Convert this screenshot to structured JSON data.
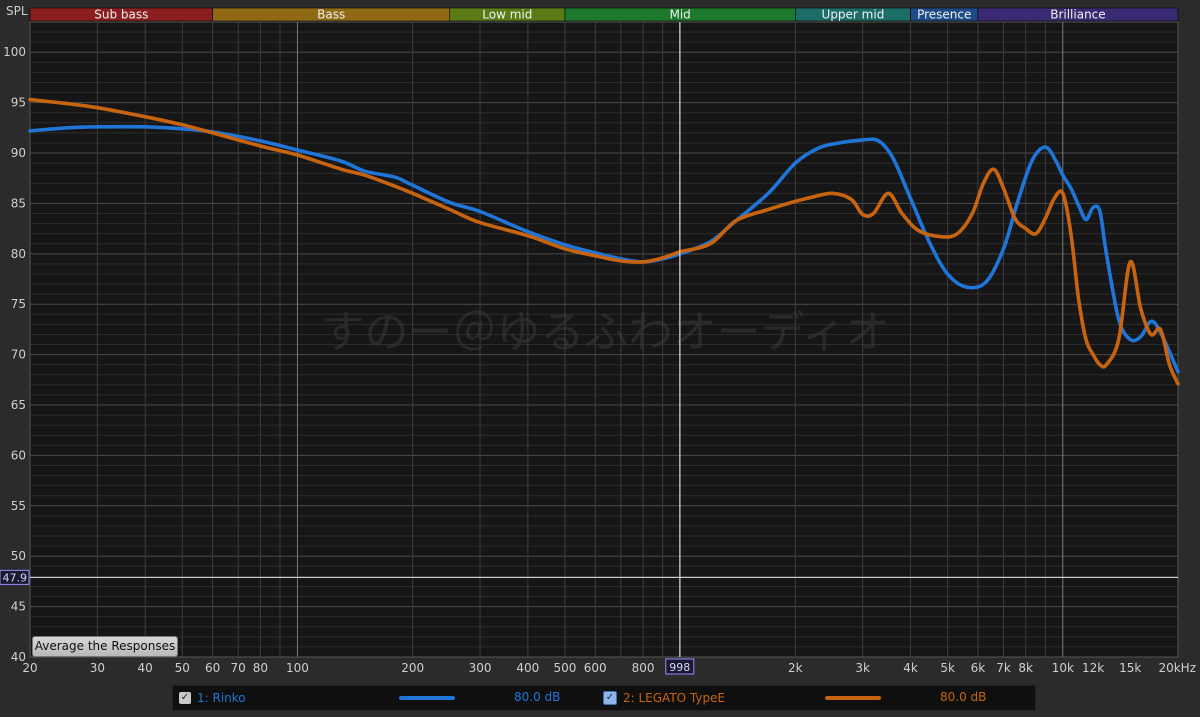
{
  "colors": {
    "background": "#161616",
    "grid": "#3a3a3a",
    "series1": "#1f75d8",
    "series2": "#c8640f",
    "cursor": "#e6e6e6"
  },
  "bands": [
    {
      "label": "Sub bass",
      "from": 20,
      "to": 60,
      "color": "#8b1f1f"
    },
    {
      "label": "Bass",
      "from": 60,
      "to": 250,
      "color": "#8f6a12"
    },
    {
      "label": "Low mid",
      "from": 250,
      "to": 500,
      "color": "#5b7b16"
    },
    {
      "label": "Mid",
      "from": 500,
      "to": 2000,
      "color": "#1d7a2c"
    },
    {
      "label": "Upper mid",
      "from": 2000,
      "to": 4000,
      "color": "#1c6c68"
    },
    {
      "label": "Presence",
      "from": 4000,
      "to": 6000,
      "color": "#1c4b86"
    },
    {
      "label": "Brilliance",
      "from": 6000,
      "to": 20000,
      "color": "#3a2a73"
    }
  ],
  "axis_label": "SPL",
  "cursor": {
    "x_label": "998",
    "y_label": "47.9"
  },
  "watermark": "すのー＠ゆるふわオーディオ",
  "button_label": "Average the Responses",
  "legend": [
    {
      "checked": "✓",
      "name": "1: Rinko",
      "value": "80.0 dB",
      "color": "#1f75d8"
    },
    {
      "checked": "✓",
      "name": "2: LEGATO TypeE",
      "value": "80.0 dB",
      "color": "#c8640f"
    }
  ],
  "chart_data": {
    "type": "line",
    "xscale": "log",
    "xlim": [
      20,
      20000
    ],
    "ylim": [
      40,
      103
    ],
    "x_ticks": [
      {
        "v": 20,
        "label": "20"
      },
      {
        "v": 30,
        "label": "30"
      },
      {
        "v": 40,
        "label": "40"
      },
      {
        "v": 50,
        "label": "50"
      },
      {
        "v": 60,
        "label": "60"
      },
      {
        "v": 70,
        "label": "70"
      },
      {
        "v": 80,
        "label": "80"
      },
      {
        "v": 100,
        "label": "100"
      },
      {
        "v": 200,
        "label": "200"
      },
      {
        "v": 300,
        "label": "300"
      },
      {
        "v": 400,
        "label": "400"
      },
      {
        "v": 500,
        "label": "500"
      },
      {
        "v": 600,
        "label": "600"
      },
      {
        "v": 800,
        "label": "800"
      },
      {
        "v": 2000,
        "label": "2k"
      },
      {
        "v": 3000,
        "label": "3k"
      },
      {
        "v": 4000,
        "label": "4k"
      },
      {
        "v": 5000,
        "label": "5k"
      },
      {
        "v": 6000,
        "label": "6k"
      },
      {
        "v": 7000,
        "label": "7k"
      },
      {
        "v": 8000,
        "label": "8k"
      },
      {
        "v": 10000,
        "label": "10k"
      },
      {
        "v": 12000,
        "label": "12k"
      },
      {
        "v": 15000,
        "label": "15k"
      },
      {
        "v": 20000,
        "label": "20kHz"
      }
    ],
    "y_ticks": [
      40,
      45,
      50,
      55,
      60,
      65,
      70,
      75,
      80,
      85,
      90,
      95,
      100
    ],
    "series": [
      {
        "name": "1: Rinko",
        "color": "#1f75d8",
        "x": [
          20,
          25,
          30,
          40,
          50,
          60,
          80,
          100,
          130,
          150,
          180,
          200,
          250,
          300,
          400,
          500,
          600,
          700,
          800,
          900,
          1000,
          1200,
          1400,
          1700,
          2000,
          2300,
          2600,
          3000,
          3300,
          3600,
          4000,
          4500,
          5000,
          5600,
          6300,
          7000,
          7600,
          8300,
          9000,
          9600,
          10000,
          10500,
          11000,
          11500,
          12000,
          12500,
          13000,
          14000,
          15000,
          16000,
          17000,
          18000,
          20000
        ],
        "y": [
          92.2,
          92.5,
          92.6,
          92.6,
          92.4,
          92.1,
          91.2,
          90.3,
          89.2,
          88.2,
          87.6,
          86.8,
          85.1,
          84.2,
          82.2,
          80.9,
          80.1,
          79.5,
          79.2,
          79.5,
          80.0,
          81.2,
          83.3,
          86.0,
          89.0,
          90.5,
          91.0,
          91.3,
          91.2,
          89.5,
          85.5,
          81.0,
          78.0,
          76.7,
          77.2,
          80.5,
          85.0,
          89.2,
          90.6,
          89.2,
          87.8,
          86.5,
          84.8,
          83.4,
          84.6,
          84.2,
          80.0,
          73.5,
          71.5,
          71.8,
          73.3,
          72.2,
          68.3
        ]
      },
      {
        "name": "2: LEGATO TypeE",
        "color": "#c8640f",
        "x": [
          20,
          25,
          30,
          40,
          50,
          60,
          80,
          100,
          130,
          150,
          180,
          200,
          250,
          300,
          400,
          500,
          600,
          700,
          800,
          900,
          1000,
          1200,
          1400,
          1700,
          2000,
          2200,
          2500,
          2800,
          3000,
          3200,
          3500,
          3800,
          4200,
          4800,
          5300,
          5800,
          6200,
          6600,
          7000,
          7500,
          8000,
          8500,
          9000,
          9500,
          10000,
          10500,
          11000,
          11500,
          12000,
          12500,
          13000,
          14000,
          15000,
          16000,
          17000,
          18000,
          19000,
          20000
        ],
        "y": [
          95.3,
          94.9,
          94.5,
          93.6,
          92.8,
          92.0,
          90.7,
          89.8,
          88.4,
          87.8,
          86.7,
          86.0,
          84.4,
          83.1,
          81.8,
          80.5,
          79.8,
          79.3,
          79.2,
          79.6,
          80.2,
          81.0,
          83.3,
          84.4,
          85.2,
          85.6,
          86.0,
          85.4,
          83.9,
          84.0,
          86.0,
          84.0,
          82.3,
          81.7,
          82.0,
          84.0,
          87.0,
          88.4,
          86.5,
          83.5,
          82.5,
          82.0,
          83.5,
          85.5,
          86.0,
          82.0,
          75.5,
          71.5,
          70.0,
          69.0,
          69.0,
          71.5,
          79.2,
          74.5,
          72.0,
          72.5,
          69.0,
          67.1
        ]
      }
    ]
  }
}
